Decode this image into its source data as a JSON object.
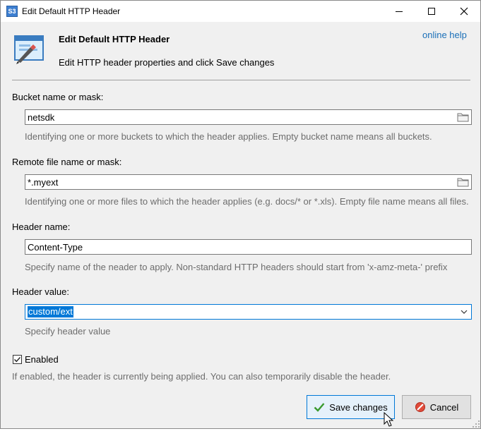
{
  "window": {
    "app_icon_text": "S3",
    "title": "Edit Default HTTP Header",
    "minimize_icon": "minimize-icon",
    "maximize_icon": "maximize-icon",
    "close_icon": "close-icon"
  },
  "header": {
    "title": "Edit Default HTTP Header",
    "subtitle": "Edit HTTP header properties and click Save changes",
    "help_link": "online help"
  },
  "bucket": {
    "label": "Bucket name or mask:",
    "value": "netsdk",
    "hint": "Identifying one or more buckets to which the header applies. Empty bucket name means all buckets."
  },
  "remote_file": {
    "label": "Remote file name or mask:",
    "value": "*.myext",
    "hint": "Identifying one or more files to which the header applies (e.g. docs/* or *.xls). Empty file name means all files."
  },
  "header_name": {
    "label": "Header name:",
    "value": "Content-Type",
    "hint": "Specify name of the neader to apply. Non-standard HTTP headers should start from 'x-amz-meta-' prefix"
  },
  "header_value": {
    "label": "Header value:",
    "value": "custom/ext",
    "hint": "Specify header value"
  },
  "enabled": {
    "checked": true,
    "label": "Enabled",
    "hint": "If enabled, the header is currently being applied. You can also temporarily disable the header."
  },
  "buttons": {
    "save": "Save changes",
    "cancel": "Cancel"
  },
  "colors": {
    "accent": "#0078d7",
    "link": "#1a6fb8",
    "hint_text": "#6d6d6d"
  }
}
